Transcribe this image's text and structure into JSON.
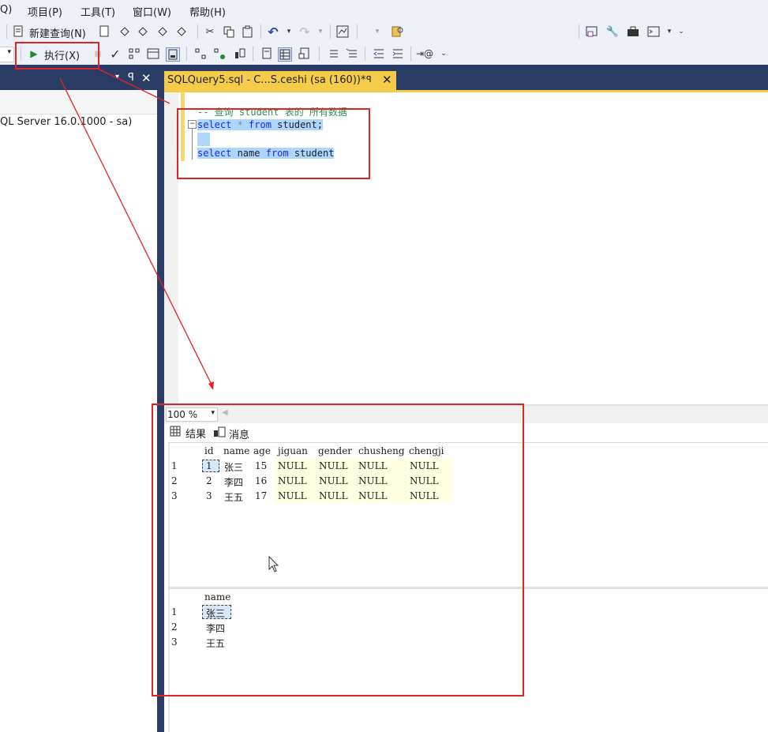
{
  "menu": {
    "items": [
      "Q)",
      "项目(P)",
      "工具(T)",
      "窗口(W)",
      "帮助(H)"
    ]
  },
  "toolbar1": {
    "new_query_label": "新建查询(N)",
    "icon_labels": [
      "MDX",
      "DMX",
      "XMLA",
      "DAX"
    ]
  },
  "toolbar2": {
    "execute_label": "执行(X)"
  },
  "object_explorer": {
    "server_node": "QL Server 16.0.1000 - sa)"
  },
  "editor": {
    "tab_title": "SQLQuery5.sql - C...S.ceshi (sa (160))*",
    "lines": {
      "comment": "-- 查询 student 表的 所有数据",
      "q1_kw1": "select",
      "q1_star": " * ",
      "q1_kw2": "from",
      "q1_rest": " student;",
      "q2_kw1": "select",
      "q2_col": " name ",
      "q2_kw2": "from",
      "q2_rest": " student"
    }
  },
  "results": {
    "zoom": "100 %",
    "tab_results": "结果",
    "tab_messages": "消息",
    "grid1": {
      "columns": [
        "id",
        "name",
        "age",
        "jiguan",
        "gender",
        "chusheng",
        "chengji"
      ],
      "rows": [
        {
          "n": "1",
          "cells": [
            "1",
            "张三",
            "15",
            "NULL",
            "NULL",
            "NULL",
            "NULL"
          ]
        },
        {
          "n": "2",
          "cells": [
            "2",
            "李四",
            "16",
            "NULL",
            "NULL",
            "NULL",
            "NULL"
          ]
        },
        {
          "n": "3",
          "cells": [
            "3",
            "王五",
            "17",
            "NULL",
            "NULL",
            "NULL",
            "NULL"
          ]
        }
      ]
    },
    "grid2": {
      "columns": [
        "name"
      ],
      "rows": [
        {
          "n": "1",
          "cells": [
            "张三"
          ]
        },
        {
          "n": "2",
          "cells": [
            "李四"
          ]
        },
        {
          "n": "3",
          "cells": [
            "王五"
          ]
        }
      ]
    }
  },
  "colors": {
    "chrome_dark": "#2a3b65",
    "tab_active": "#f5cc4a",
    "annotation_red": "#e02424",
    "selection": "#add6ff",
    "null_cell": "#ffffe1"
  }
}
